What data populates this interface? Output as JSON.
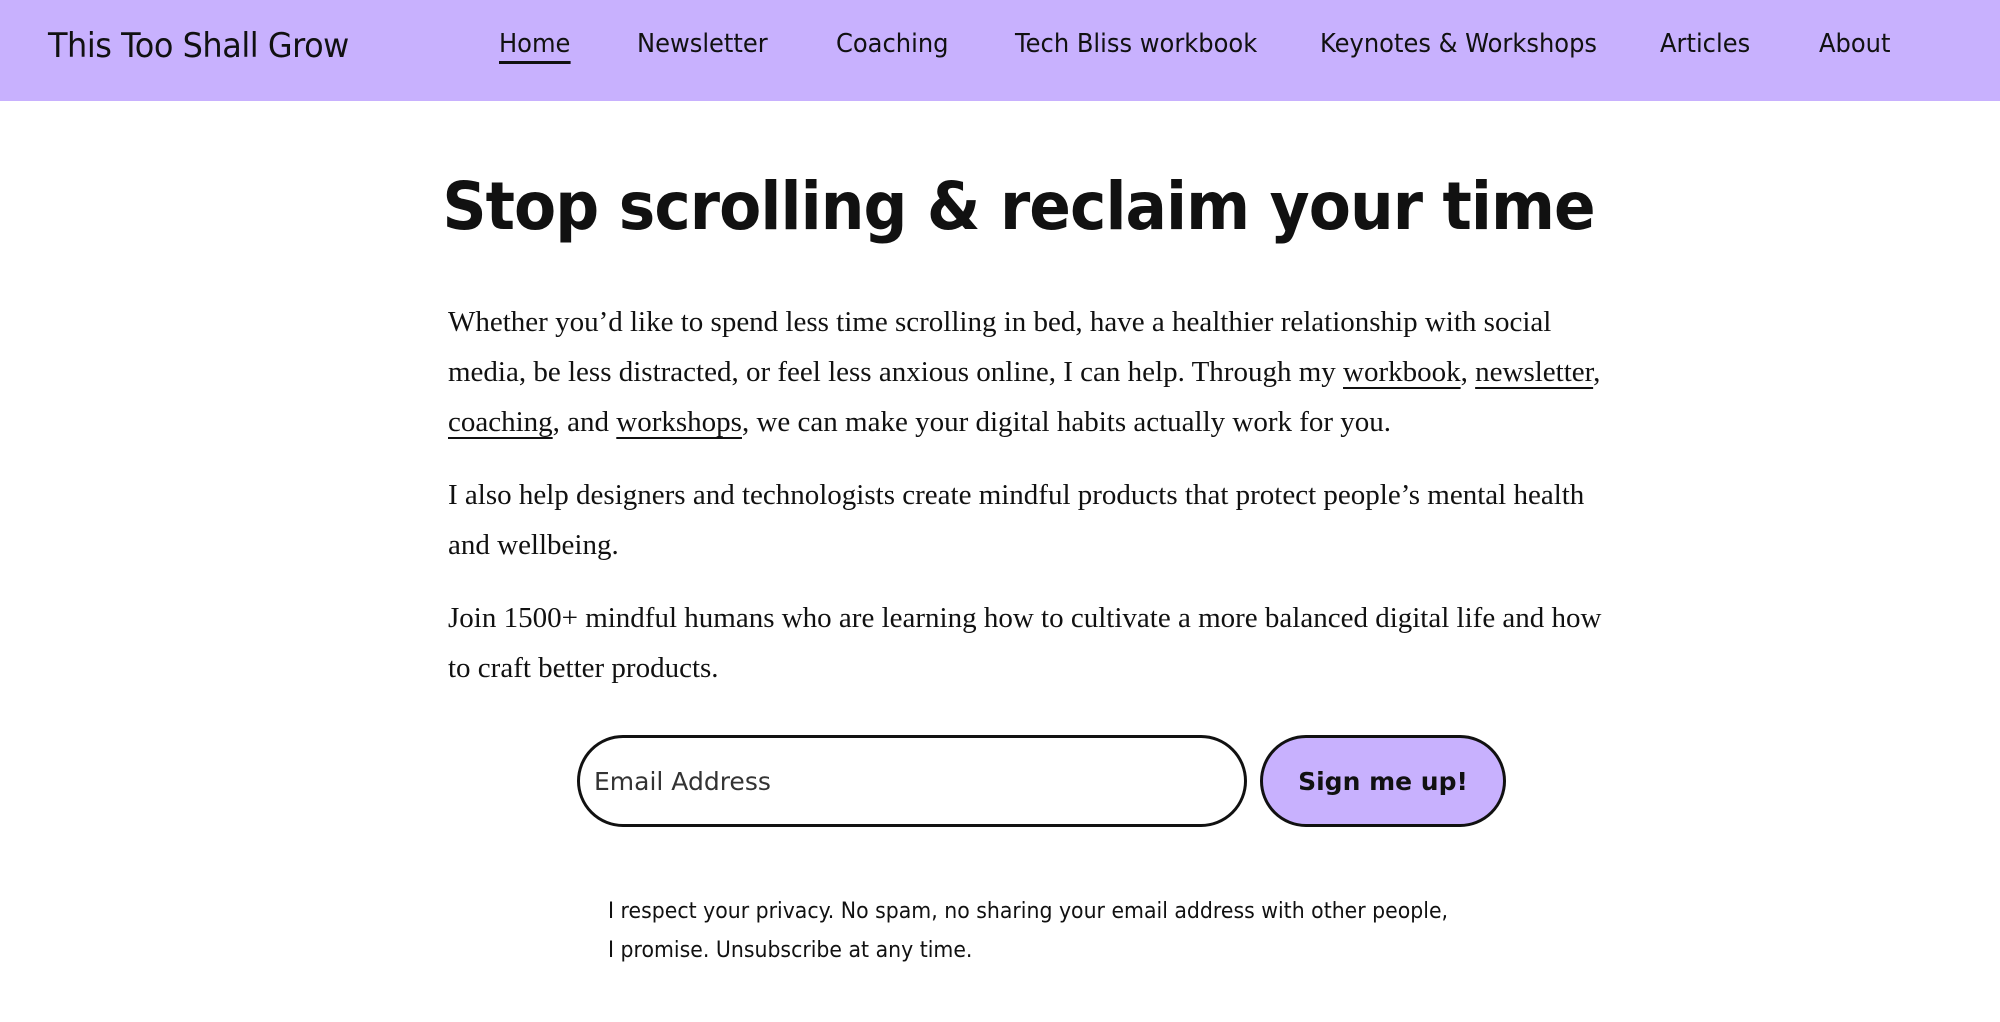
{
  "header": {
    "site_title": "This Too Shall Grow",
    "nav": [
      {
        "label": "Home",
        "active": true
      },
      {
        "label": "Newsletter"
      },
      {
        "label": "Coaching"
      },
      {
        "label": "Tech Bliss workbook"
      },
      {
        "label": "Keynotes & Workshops"
      },
      {
        "label": "Articles"
      },
      {
        "label": "About"
      }
    ]
  },
  "hero": {
    "title": "Stop scrolling & reclaim your time",
    "p1": {
      "t1": "Whether you’d like to spend less time scrolling in bed, have a healthier relationship with social media, be less distracted, or feel less anxious online, I can help. Through my ",
      "link_workbook": "workbook",
      "t2": ", ",
      "link_newsletter": "newsletter",
      "t3": ", ",
      "link_coaching": "coaching",
      "t4": ", and ",
      "link_workshops": "workshops",
      "t5": ", we can make your digital habits actually work for you."
    },
    "p2": "I also help designers and technologists create mindful products that protect people’s mental health and wellbeing.",
    "p3": "Join 1500+ mindful humans who are learning how to cultivate a more balanced digital life and how to craft better products."
  },
  "signup": {
    "email_placeholder": "Email Address",
    "email_value": "",
    "button_label": "Sign me up!",
    "privacy_line1": "I respect your privacy. No spam, no sharing your email address with other people,",
    "privacy_line2": "I promise. Unsubscribe at any time."
  },
  "colors": {
    "accent": "#c8b1fe",
    "text": "#111111",
    "background": "#ffffff"
  }
}
